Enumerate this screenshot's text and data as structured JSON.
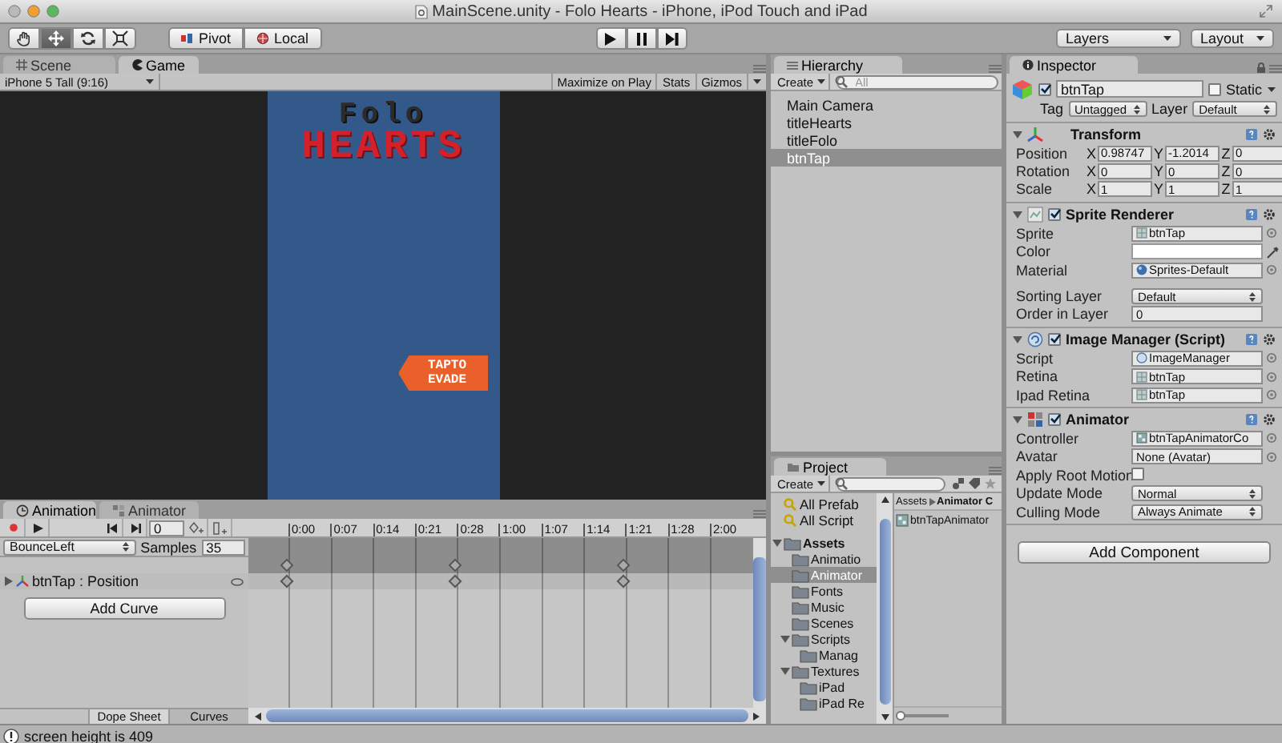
{
  "window": {
    "title": "MainScene.unity - Folo Hearts - iPhone, iPod Touch and iPad"
  },
  "toolbar": {
    "tools": [
      {
        "kind": "hand",
        "selected": false
      },
      {
        "kind": "move",
        "selected": true
      },
      {
        "kind": "rotate",
        "selected": false
      },
      {
        "kind": "scale",
        "selected": false
      }
    ],
    "pivot": "Pivot",
    "local": "Local",
    "playback": [
      {
        "kind": "play"
      },
      {
        "kind": "pause"
      },
      {
        "kind": "step"
      }
    ],
    "layers": "Layers",
    "layout": "Layout"
  },
  "game_panel": {
    "tabs": [
      {
        "label": "Scene",
        "kind": "scene",
        "selected": false
      },
      {
        "label": "Game",
        "kind": "game",
        "selected": true
      }
    ],
    "aspect": "iPhone 5 Tall (9:16)",
    "buttons": [
      "Maximize on Play",
      "Stats",
      "Gizmos"
    ],
    "logo_top": "Folo",
    "logo_bottom": "HEARTS",
    "tap_button": [
      "TAPTO",
      "EVADE"
    ]
  },
  "animation_panel": {
    "tabs": [
      {
        "label": "Animation",
        "kind": "animation",
        "selected": true
      },
      {
        "label": "Animator",
        "kind": "animator",
        "selected": false
      }
    ],
    "frame": "0",
    "clip": "BounceLeft",
    "samples_label": "Samples",
    "samples": "35",
    "ticks": [
      {
        "label": "0:00",
        "keyframe": true
      },
      {
        "label": "0:07",
        "keyframe": false
      },
      {
        "label": "0:14",
        "keyframe": false
      },
      {
        "label": "0:21",
        "keyframe": false
      },
      {
        "label": "0:28",
        "keyframe": true
      },
      {
        "label": "1:00",
        "keyframe": false
      },
      {
        "label": "1:07",
        "keyframe": false
      },
      {
        "label": "1:14",
        "keyframe": false
      },
      {
        "label": "1:21",
        "keyframe": true
      },
      {
        "label": "1:28",
        "keyframe": false
      },
      {
        "label": "2:00",
        "keyframe": false
      }
    ],
    "track": "btnTap : Position",
    "add_curve": "Add Curve",
    "view_tabs": [
      {
        "label": "Dope Sheet",
        "selected": true
      },
      {
        "label": "Curves",
        "selected": false
      }
    ]
  },
  "hierarchy": {
    "title": "Hierarchy",
    "create": "Create",
    "search_placeholder": "All",
    "items": [
      {
        "label": "Main Camera",
        "selected": false
      },
      {
        "label": "titleHearts",
        "selected": false
      },
      {
        "label": "titleFolo",
        "selected": false
      },
      {
        "label": "btnTap",
        "selected": true
      }
    ]
  },
  "project": {
    "title": "Project",
    "create": "Create",
    "favorites": [
      "All Prefab",
      "All Script"
    ],
    "tree": [
      {
        "label": "Assets",
        "selected": false,
        "expanded": true,
        "children": [
          {
            "label": "Animatio",
            "selected": false
          },
          {
            "label": "Animator",
            "selected": true
          },
          {
            "label": "Fonts",
            "selected": false
          },
          {
            "label": "Music",
            "selected": false
          },
          {
            "label": "Scenes",
            "selected": false
          },
          {
            "label": "Scripts",
            "selected": false,
            "expanded": true,
            "children": [
              {
                "label": "Manag",
                "selected": false
              }
            ]
          },
          {
            "label": "Textures",
            "selected": false,
            "expanded": true,
            "children": [
              {
                "label": "iPad",
                "selected": false
              },
              {
                "label": "iPad Re",
                "selected": false
              }
            ]
          }
        ]
      }
    ],
    "breadcrumb": [
      "Assets",
      "Animator C"
    ],
    "files": [
      "btnTapAnimator"
    ],
    "size_slider": {
      "level": 0
    }
  },
  "inspector": {
    "title": "Inspector",
    "object": {
      "active": true,
      "name": "btnTap",
      "static_label": "Static",
      "static": false,
      "tag_label": "Tag",
      "tag": "Untagged",
      "layer_label": "Layer",
      "layer": "Default"
    },
    "components": [
      {
        "kind": "transform",
        "title": "Transform",
        "rows": [
          {
            "kind": "vector",
            "label": "Position",
            "values": [
              {
                "axis": "X",
                "value": "0.98747"
              },
              {
                "axis": "Y",
                "value": "-1.2014"
              },
              {
                "axis": "Z",
                "value": "0"
              }
            ]
          },
          {
            "kind": "vector",
            "label": "Rotation",
            "values": [
              {
                "axis": "X",
                "value": "0"
              },
              {
                "axis": "Y",
                "value": "0"
              },
              {
                "axis": "Z",
                "value": "0"
              }
            ]
          },
          {
            "kind": "vector",
            "label": "Scale",
            "values": [
              {
                "axis": "X",
                "value": "1"
              },
              {
                "axis": "Y",
                "value": "1"
              },
              {
                "axis": "Z",
                "value": "1"
              }
            ]
          }
        ]
      },
      {
        "kind": "sprite_renderer",
        "title": "Sprite Renderer",
        "enabled": true,
        "rows": [
          {
            "kind": "sprite",
            "label": "Sprite",
            "value": "btnTap"
          },
          {
            "kind": "color",
            "label": "Color",
            "color": "#ffffff"
          },
          {
            "kind": "material",
            "label": "Material",
            "value": "Sprites-Default"
          },
          {
            "kind": "dropdown",
            "label": "Sorting Layer",
            "value": "Default",
            "group_break": true
          },
          {
            "kind": "text",
            "label": "Order in Layer",
            "value": "0"
          }
        ]
      },
      {
        "kind": "script",
        "title": "Image Manager (Script)",
        "enabled": true,
        "rows": [
          {
            "kind": "script",
            "label": "Script",
            "value": "ImageManager"
          },
          {
            "kind": "sprite",
            "label": "Retina",
            "value": "btnTap"
          },
          {
            "kind": "sprite",
            "label": "Ipad Retina",
            "value": "btnTap"
          }
        ]
      },
      {
        "kind": "animator",
        "title": "Animator",
        "enabled": true,
        "rows": [
          {
            "kind": "controller",
            "label": "Controller",
            "value": "btnTapAnimatorCo"
          },
          {
            "kind": "object",
            "label": "Avatar",
            "value": "None (Avatar)"
          },
          {
            "kind": "checkbox",
            "label": "Apply Root Motion",
            "checked": false
          },
          {
            "kind": "dropdown",
            "label": "Update Mode",
            "value": "Normal"
          },
          {
            "kind": "dropdown",
            "label": "Culling Mode",
            "value": "Always Animate"
          }
        ]
      }
    ],
    "add_component": "Add Component"
  },
  "status_bar": {
    "message": "screen height is 409"
  }
}
